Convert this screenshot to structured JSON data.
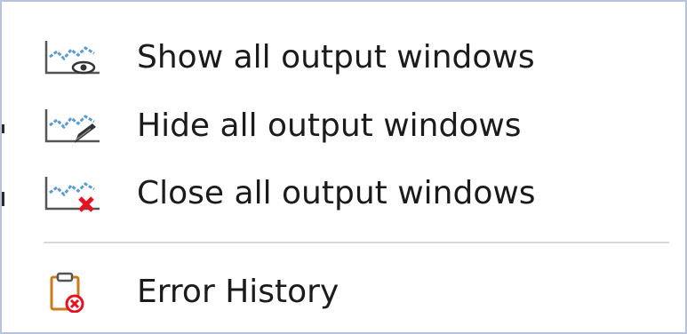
{
  "menu": {
    "items": [
      {
        "label": "Show all output windows",
        "icon": "chart-eye-icon"
      },
      {
        "label": "Hide all output windows",
        "icon": "chart-pen-icon"
      },
      {
        "label": "Close all output windows",
        "icon": "chart-close-icon"
      },
      {
        "label": "Error History",
        "icon": "clipboard-error-icon"
      }
    ]
  },
  "colors": {
    "border": "#b7c3dd",
    "chart_blue": "#5b9bd5",
    "close_red": "#e81123",
    "clipboard_orange": "#c97a1b",
    "text": "#1b1b1b"
  }
}
